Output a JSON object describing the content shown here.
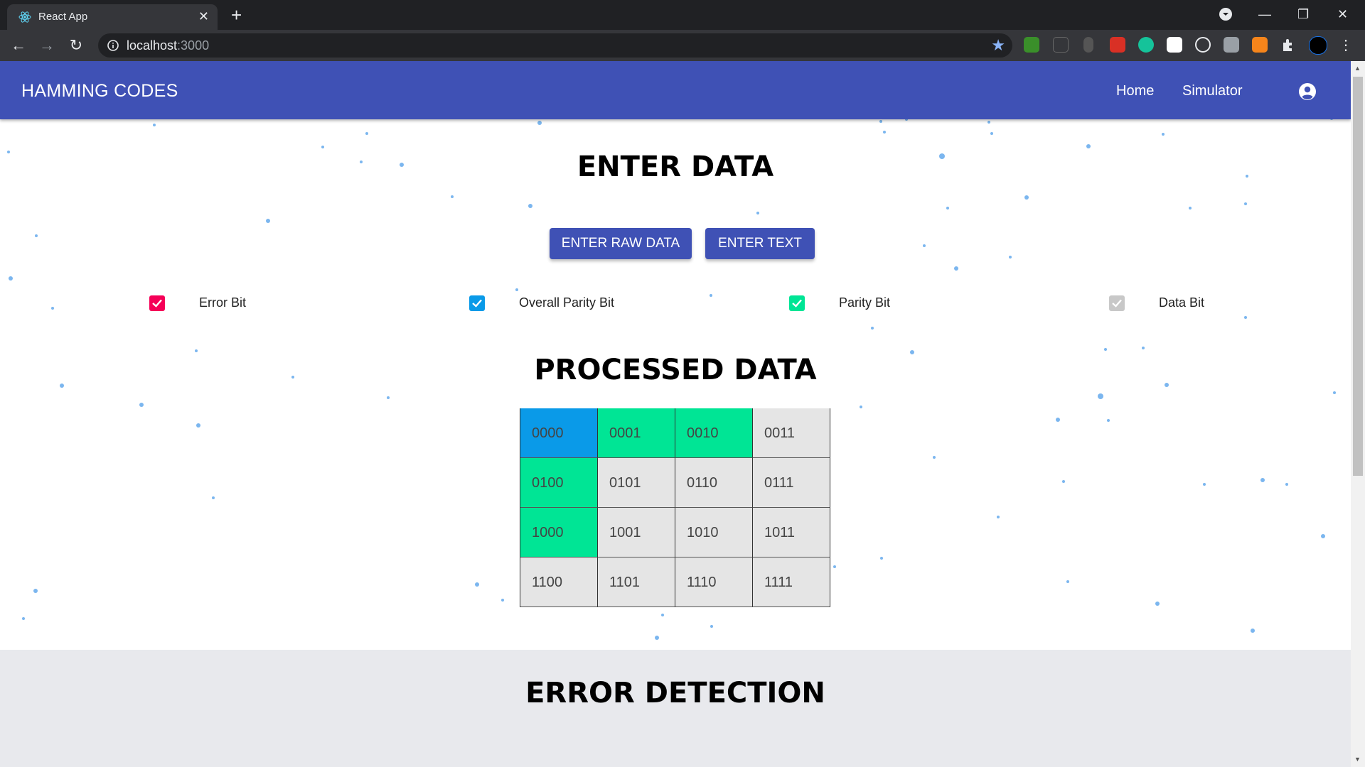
{
  "browser": {
    "tab_title": "React App",
    "tab_close": "✕",
    "new_tab": "+",
    "url_host": "localhost",
    "url_port": ":3000",
    "controls": {
      "minimize": "—",
      "restore": "❐",
      "close": "✕"
    }
  },
  "appbar": {
    "brand": "HAMMING CODES",
    "nav": [
      {
        "label": "Home"
      },
      {
        "label": "Simulator"
      }
    ]
  },
  "enter": {
    "title": "ENTER DATA",
    "buttons": [
      {
        "label": "ENTER RAW DATA"
      },
      {
        "label": "ENTER TEXT"
      }
    ]
  },
  "legend": [
    {
      "label": "Error Bit",
      "color": "#f50057"
    },
    {
      "label": "Overall Parity Bit",
      "color": "#0a9ae8"
    },
    {
      "label": "Parity Bit",
      "color": "#00e595"
    },
    {
      "label": "Data Bit",
      "color": "#c8c8c8"
    }
  ],
  "processed": {
    "title": "PROCESSED DATA",
    "cells": [
      {
        "bits": "0000",
        "type": "overall-parity"
      },
      {
        "bits": "0001",
        "type": "parity"
      },
      {
        "bits": "0010",
        "type": "parity"
      },
      {
        "bits": "0011",
        "type": "data"
      },
      {
        "bits": "0100",
        "type": "parity"
      },
      {
        "bits": "0101",
        "type": "data"
      },
      {
        "bits": "0110",
        "type": "data"
      },
      {
        "bits": "0111",
        "type": "data"
      },
      {
        "bits": "1000",
        "type": "parity"
      },
      {
        "bits": "1001",
        "type": "data"
      },
      {
        "bits": "1010",
        "type": "data"
      },
      {
        "bits": "1011",
        "type": "data"
      },
      {
        "bits": "1100",
        "type": "data"
      },
      {
        "bits": "1101",
        "type": "data"
      },
      {
        "bits": "1110",
        "type": "data"
      },
      {
        "bits": "1111",
        "type": "data"
      }
    ]
  },
  "detection": {
    "title": "ERROR DETECTION"
  },
  "colors": {
    "appbar": "#3f51b5",
    "button": "#3f51b5",
    "overall_parity": "#0a9ae8",
    "parity": "#00e595",
    "data": "#e5e5e5",
    "error": "#f50057"
  }
}
